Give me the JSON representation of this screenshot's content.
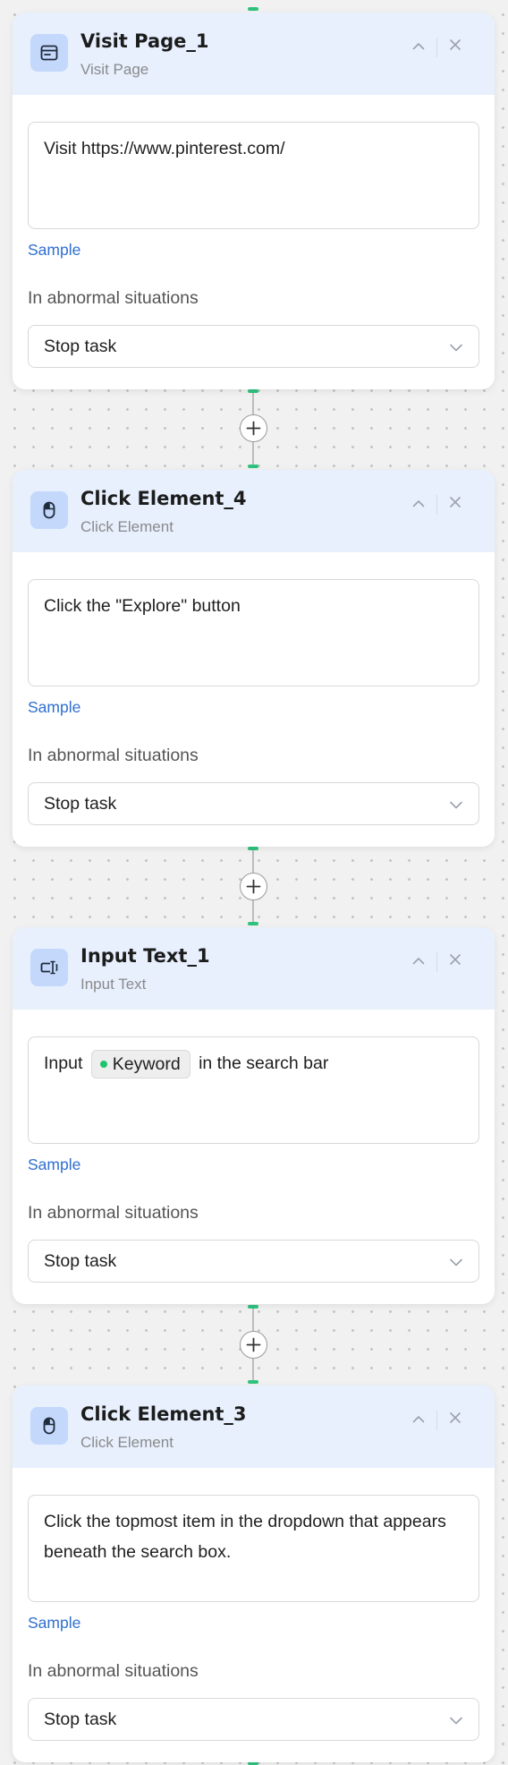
{
  "steps": [
    {
      "title": "Visit Page_1",
      "subtitle": "Visit Page",
      "icon": "browser-window-icon",
      "description": "Visit https://www.pinterest.com/",
      "sample_label": "Sample",
      "abnormal_label": "In abnormal situations",
      "abnormal_value": "Stop task"
    },
    {
      "title": "Click Element_4",
      "subtitle": "Click Element",
      "icon": "mouse-icon",
      "description": "Click the \"Explore\" button",
      "sample_label": "Sample",
      "abnormal_label": "In abnormal situations",
      "abnormal_value": "Stop task"
    },
    {
      "title": "Input Text_1",
      "subtitle": "Input Text",
      "icon": "input-text-icon",
      "description_before": "Input",
      "variable_chip": "Keyword",
      "description_after": "in the search bar",
      "sample_label": "Sample",
      "abnormal_label": "In abnormal situations",
      "abnormal_value": "Stop task"
    },
    {
      "title": "Click Element_3",
      "subtitle": "Click Element",
      "icon": "mouse-icon",
      "description": "Click the topmost item in the dropdown that appears beneath the search box.",
      "sample_label": "Sample",
      "abnormal_label": "In abnormal situations",
      "abnormal_value": "Stop task"
    }
  ],
  "colors": {
    "header_bg": "#e8f0fe",
    "icon_bg": "#c3d8fb",
    "link": "#2f6fd0",
    "connector_accent": "#2ec27e",
    "variable_dot": "#21c46b"
  }
}
